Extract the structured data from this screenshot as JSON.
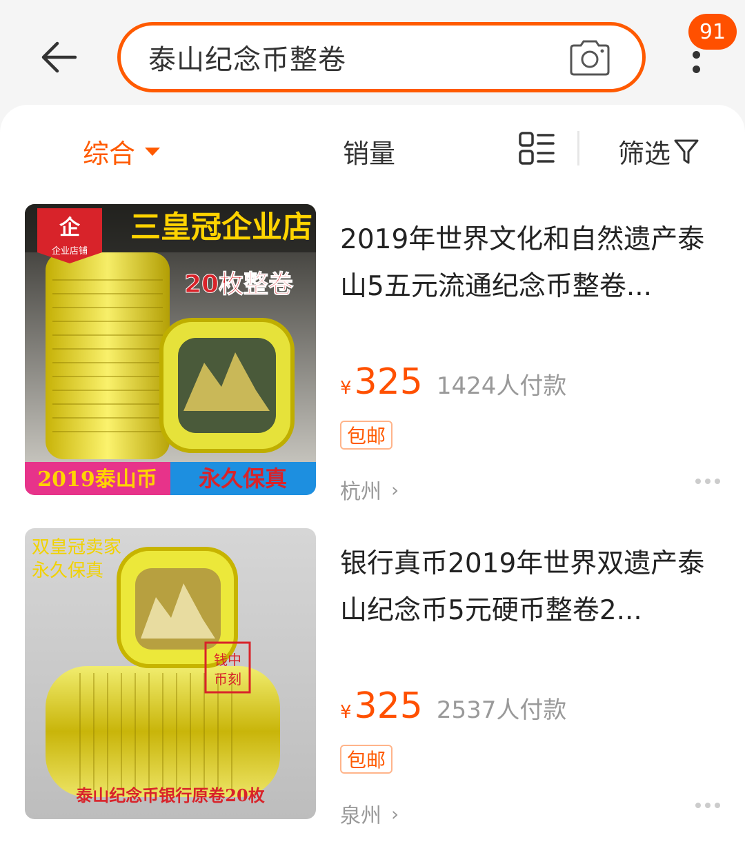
{
  "header": {
    "search_query": "泰山纪念币整卷",
    "badge_count": "91"
  },
  "sortbar": {
    "comprehensive": "综合",
    "sales": "销量",
    "filter": "筛选"
  },
  "products": [
    {
      "title": "2019年世界文化和自然遗产泰山5五元流通纪念币整卷...",
      "price_symbol": "¥",
      "price": "325",
      "sold": "1424人付款",
      "tag": "包邮",
      "location": "杭州",
      "image_texts": {
        "shop": "三皇冠企业店",
        "badge": "企业店铺",
        "count": "20枚整卷",
        "left_banner": "2019泰山币",
        "right_banner": "永久保真"
      }
    },
    {
      "title": "银行真币2019年世界双遗产泰山纪念币5元硬币整卷2...",
      "price_symbol": "¥",
      "price": "325",
      "sold": "2537人付款",
      "tag": "包邮",
      "location": "泉州",
      "image_texts": {
        "seller_line1": "双皇冠卖家",
        "seller_line2": "永久保真",
        "stamp": "钱币中刻",
        "bottom": "泰山纪念币银行原卷20枚"
      }
    }
  ],
  "colors": {
    "accent": "#ff5a00",
    "price": "#ff5000"
  }
}
